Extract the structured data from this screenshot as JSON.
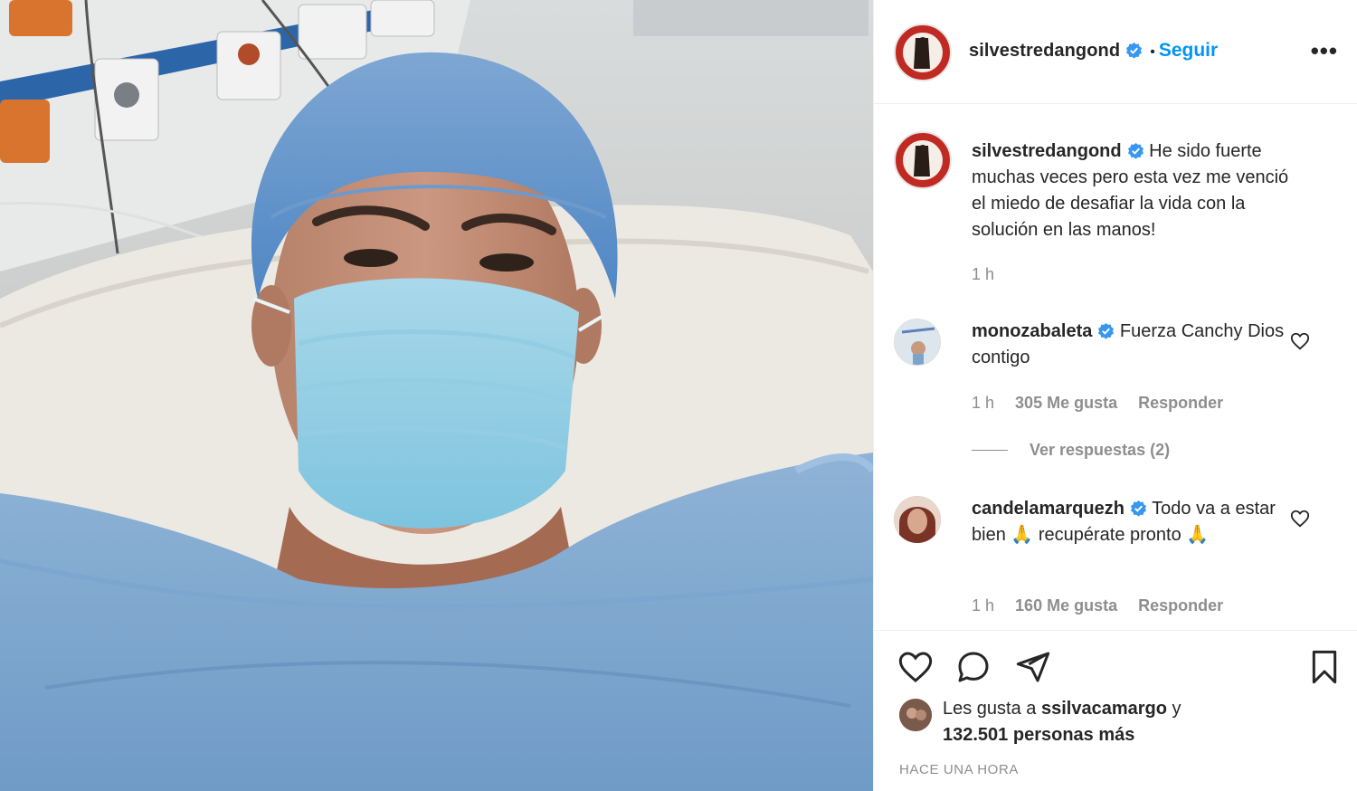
{
  "post": {
    "username": "silvestredangond",
    "separator": "•",
    "follow_label": "Seguir",
    "more_label": "•••"
  },
  "caption": {
    "username": "silvestredangond",
    "text": "He sido fuerte muchas veces pero esta vez me venció el miedo de desafiar la vida con la solución en las manos!",
    "time": "1 h"
  },
  "comments": [
    {
      "username": "monozabaleta",
      "text": "Fuerza Canchy Dios contigo",
      "time": "1 h",
      "likes": "305 Me gusta",
      "reply": "Responder",
      "view_replies": "Ver respuestas (2)"
    },
    {
      "username": "candelamarquezh",
      "text": "Todo va a estar bien 🙏 recupérate pronto 🙏",
      "time": "1 h",
      "likes": "160 Me gusta",
      "reply": "Responder"
    }
  ],
  "likes": {
    "prefix": "Les gusta a ",
    "user": "ssilvacamargo",
    "middle": " y",
    "count": "132.501 personas más"
  },
  "timestamp": "HACE UNA HORA",
  "colors": {
    "accent": "#0095f6",
    "text": "#262626",
    "muted": "#8e8e8e",
    "avatar_red": "#c12a22"
  },
  "icons": [
    "heart-icon",
    "comment-icon",
    "share-icon",
    "bookmark-icon",
    "verified-icon",
    "more-icon"
  ]
}
